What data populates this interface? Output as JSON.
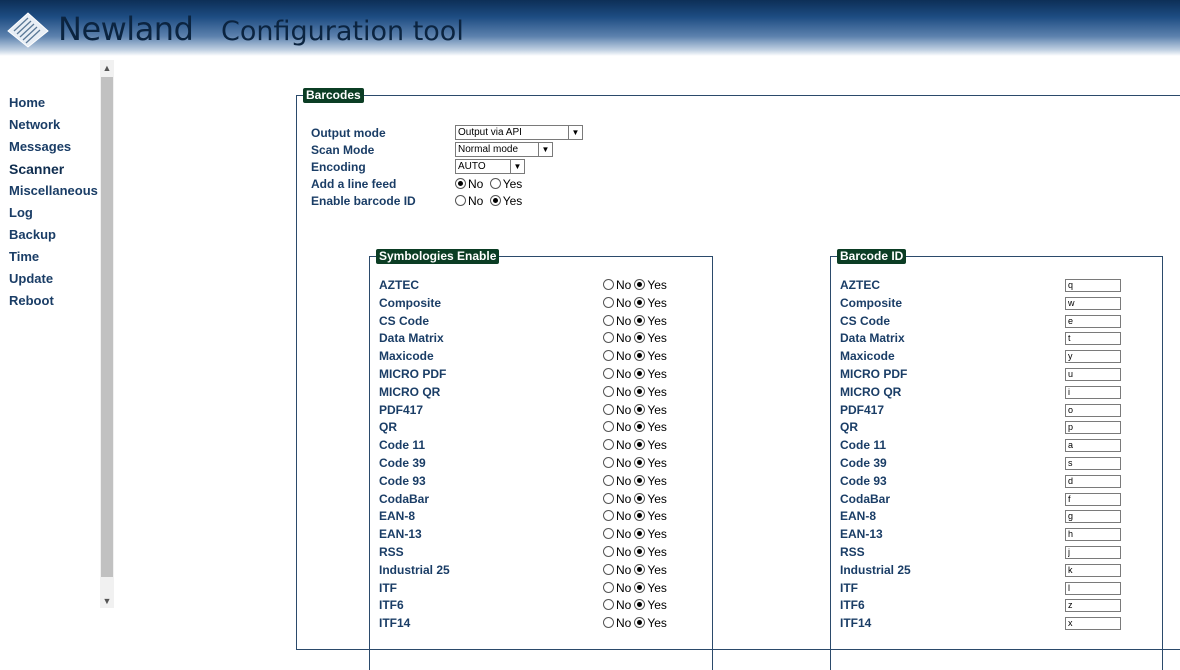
{
  "header": {
    "brand": "Newland",
    "title": "Configuration tool"
  },
  "nav": [
    {
      "label": "Home",
      "active": false
    },
    {
      "label": "Network",
      "active": false
    },
    {
      "label": "Messages",
      "active": false
    },
    {
      "label": "Scanner",
      "active": true
    },
    {
      "label": "Miscellaneous",
      "active": false
    },
    {
      "label": "Log",
      "active": false
    },
    {
      "label": "Backup",
      "active": false
    },
    {
      "label": "Time",
      "active": false
    },
    {
      "label": "Update",
      "active": false
    },
    {
      "label": "Reboot",
      "active": false
    }
  ],
  "barcodes": {
    "legend": "Barcodes",
    "output_mode": {
      "label": "Output mode",
      "value": "Output via API"
    },
    "scan_mode": {
      "label": "Scan Mode",
      "value": "Normal mode"
    },
    "encoding": {
      "label": "Encoding",
      "value": "AUTO"
    },
    "line_feed": {
      "label": "Add a line feed",
      "no": "No",
      "yes": "Yes",
      "selected": "No"
    },
    "barcode_id": {
      "label": "Enable barcode ID",
      "no": "No",
      "yes": "Yes",
      "selected": "Yes"
    }
  },
  "symbologies": {
    "legend": "Symbologies Enable",
    "no_label": "No",
    "yes_label": "Yes",
    "items": [
      {
        "name": "AZTEC",
        "enabled": "Yes"
      },
      {
        "name": "Composite",
        "enabled": "Yes"
      },
      {
        "name": "CS Code",
        "enabled": "Yes"
      },
      {
        "name": "Data Matrix",
        "enabled": "Yes"
      },
      {
        "name": "Maxicode",
        "enabled": "Yes"
      },
      {
        "name": "MICRO PDF",
        "enabled": "Yes"
      },
      {
        "name": "MICRO QR",
        "enabled": "Yes"
      },
      {
        "name": "PDF417",
        "enabled": "Yes"
      },
      {
        "name": "QR",
        "enabled": "Yes"
      },
      {
        "name": "Code 11",
        "enabled": "Yes"
      },
      {
        "name": "Code 39",
        "enabled": "Yes"
      },
      {
        "name": "Code 93",
        "enabled": "Yes"
      },
      {
        "name": "CodaBar",
        "enabled": "Yes"
      },
      {
        "name": "EAN-8",
        "enabled": "Yes"
      },
      {
        "name": "EAN-13",
        "enabled": "Yes"
      },
      {
        "name": "RSS",
        "enabled": "Yes"
      },
      {
        "name": "Industrial 25",
        "enabled": "Yes"
      },
      {
        "name": "ITF",
        "enabled": "Yes"
      },
      {
        "name": "ITF6",
        "enabled": "Yes"
      },
      {
        "name": "ITF14",
        "enabled": "Yes"
      }
    ]
  },
  "barcode_ids": {
    "legend": "Barcode ID",
    "items": [
      {
        "name": "AZTEC",
        "id": "q"
      },
      {
        "name": "Composite",
        "id": "w"
      },
      {
        "name": "CS Code",
        "id": "e"
      },
      {
        "name": "Data Matrix",
        "id": "t"
      },
      {
        "name": "Maxicode",
        "id": "y"
      },
      {
        "name": "MICRO PDF",
        "id": "u"
      },
      {
        "name": "MICRO QR",
        "id": "i"
      },
      {
        "name": "PDF417",
        "id": "o"
      },
      {
        "name": "QR",
        "id": "p"
      },
      {
        "name": "Code 11",
        "id": "a"
      },
      {
        "name": "Code 39",
        "id": "s"
      },
      {
        "name": "Code 93",
        "id": "d"
      },
      {
        "name": "CodaBar",
        "id": "f"
      },
      {
        "name": "EAN-8",
        "id": "g"
      },
      {
        "name": "EAN-13",
        "id": "h"
      },
      {
        "name": "RSS",
        "id": "j"
      },
      {
        "name": "Industrial 25",
        "id": "k"
      },
      {
        "name": "ITF",
        "id": "l"
      },
      {
        "name": "ITF6",
        "id": "z"
      },
      {
        "name": "ITF14",
        "id": "x"
      }
    ]
  }
}
